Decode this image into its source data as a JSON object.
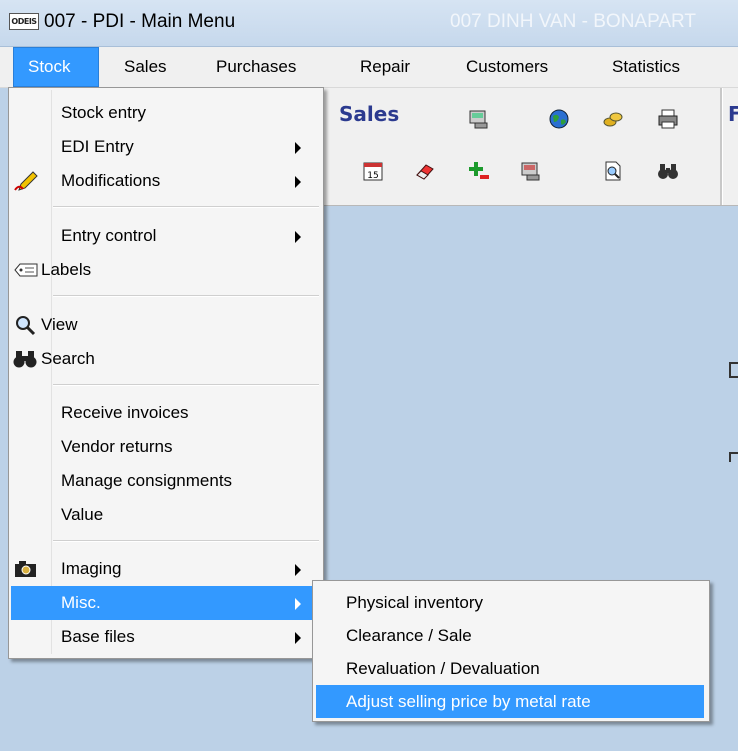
{
  "window": {
    "app_logo_text": "ODEIS",
    "title": "007 - PDI - Main Menu",
    "store_name": "007 DINH VAN - BONAPART"
  },
  "menubar": {
    "items": [
      {
        "label": "Stock",
        "active": true
      },
      {
        "label": "Sales"
      },
      {
        "label": "Purchases"
      },
      {
        "label": "Repair"
      },
      {
        "label": "Customers"
      },
      {
        "label": "Statistics"
      }
    ]
  },
  "toolbar": {
    "section_title": "Sales",
    "next_section_initial": "F",
    "icons": [
      "card-terminal-icon",
      "globe-icon",
      "coins-icon",
      "printer-icon",
      "calendar-icon",
      "eraser-icon",
      "plus-minus-icon",
      "card-reader-icon",
      "document-search-icon",
      "binoculars-icon"
    ],
    "calendar_day": "15"
  },
  "stock_menu": {
    "items": [
      {
        "label": "Stock entry"
      },
      {
        "label": "EDI Entry",
        "submenu": true
      },
      {
        "label": "Modifications",
        "submenu": true,
        "icon": "pen-icon"
      },
      {
        "label": "Entry control",
        "submenu": true
      },
      {
        "label": "Labels",
        "icon": "label-tag-icon"
      },
      {
        "label": "View",
        "icon": "magnifier-icon"
      },
      {
        "label": "Search",
        "icon": "binoculars-icon"
      },
      {
        "label": "Receive invoices"
      },
      {
        "label": "Vendor returns"
      },
      {
        "label": "Manage consignments"
      },
      {
        "label": "Value"
      },
      {
        "label": "Imaging",
        "submenu": true,
        "icon": "camera-icon"
      },
      {
        "label": "Misc.",
        "submenu": true,
        "highlighted": true
      },
      {
        "label": "Base files",
        "submenu": true
      }
    ]
  },
  "misc_submenu": {
    "items": [
      {
        "label": "Physical inventory"
      },
      {
        "label": "Clearance / Sale"
      },
      {
        "label": "Revaluation / Devaluation"
      },
      {
        "label": "Adjust selling price by metal rate",
        "highlighted": true
      }
    ]
  },
  "colors": {
    "highlight": "#3399ff",
    "workspace": "#bcd1e7",
    "title_bar": "#cbdcee",
    "section_title": "#2b3a8f"
  }
}
